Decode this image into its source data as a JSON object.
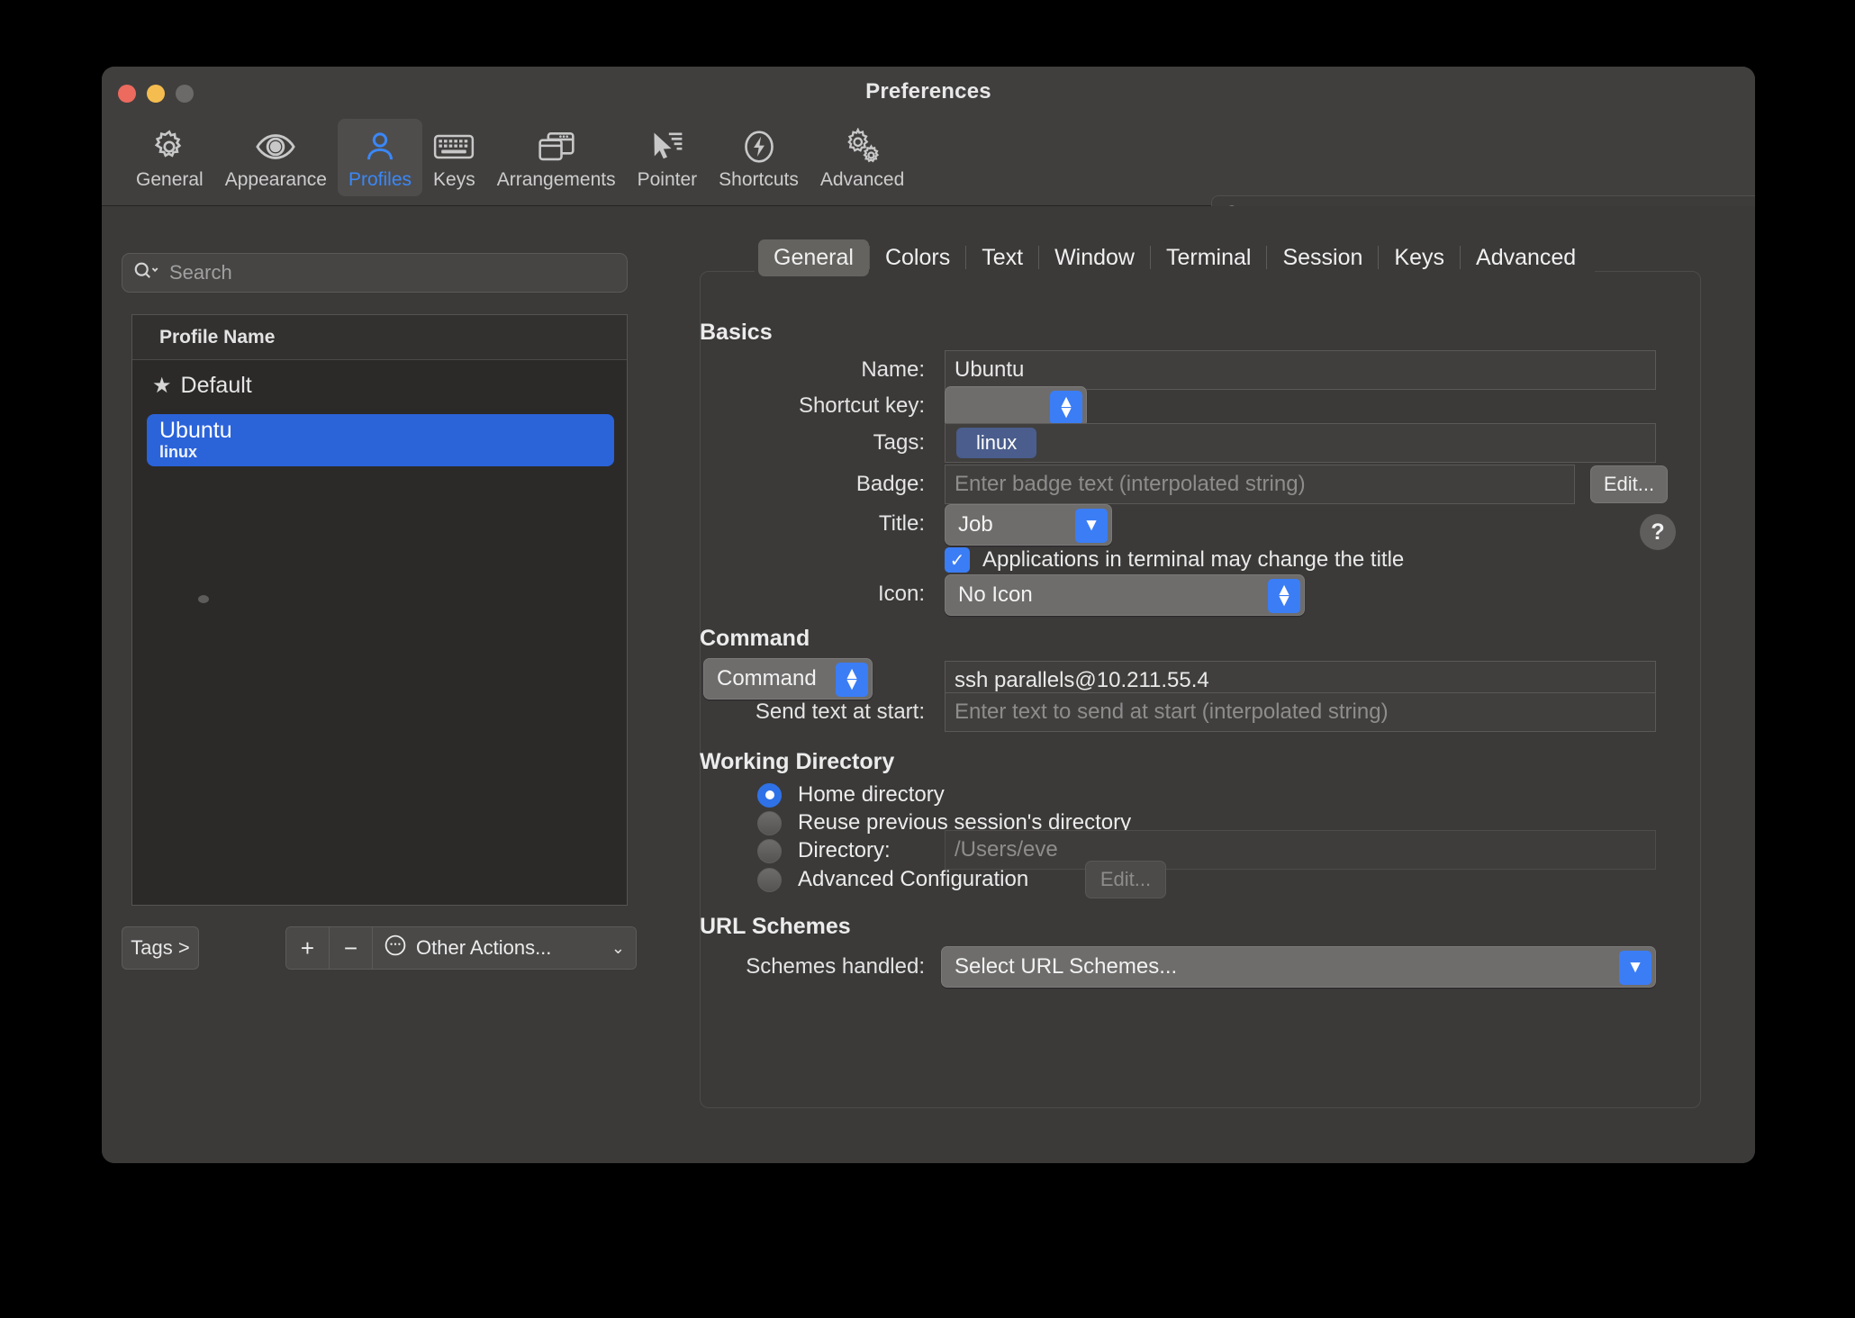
{
  "window": {
    "title": "Preferences",
    "traffic_lights": [
      "close",
      "minimize",
      "zoom"
    ]
  },
  "toolbar": {
    "items": [
      {
        "label": "General",
        "icon": "gear-icon",
        "selected": false
      },
      {
        "label": "Appearance",
        "icon": "eye-icon",
        "selected": false
      },
      {
        "label": "Profiles",
        "icon": "person-icon",
        "selected": true
      },
      {
        "label": "Keys",
        "icon": "keyboard-icon",
        "selected": false
      },
      {
        "label": "Arrangements",
        "icon": "windows-icon",
        "selected": false
      },
      {
        "label": "Pointer",
        "icon": "cursor-icon",
        "selected": false
      },
      {
        "label": "Shortcuts",
        "icon": "bolt-icon",
        "selected": false
      },
      {
        "label": "Advanced",
        "icon": "double-gear-icon",
        "selected": false
      }
    ],
    "search": {
      "value": "",
      "placeholder": "Search",
      "caption": "Search"
    }
  },
  "profiles_pane": {
    "search": {
      "value": "",
      "placeholder": "Search"
    },
    "column_header": "Profile Name",
    "rows": [
      {
        "name": "Default",
        "tag": "",
        "is_default": true,
        "selected": false
      },
      {
        "name": "Ubuntu",
        "tag": "linux",
        "is_default": false,
        "selected": true
      }
    ],
    "footer": {
      "tags_button": "Tags >",
      "add_button": "+",
      "remove_button": "−",
      "other_actions": "Other Actions...",
      "other_actions_icon": "ellipsis-circle-icon",
      "chevron": "⌄"
    }
  },
  "tabs": [
    {
      "label": "General",
      "active": true
    },
    {
      "label": "Colors",
      "active": false
    },
    {
      "label": "Text",
      "active": false
    },
    {
      "label": "Window",
      "active": false
    },
    {
      "label": "Terminal",
      "active": false
    },
    {
      "label": "Session",
      "active": false
    },
    {
      "label": "Keys",
      "active": false
    },
    {
      "label": "Advanced",
      "active": false
    }
  ],
  "general_tab": {
    "basics": {
      "heading": "Basics",
      "name": {
        "label": "Name:",
        "value": "Ubuntu"
      },
      "shortcut_key": {
        "label": "Shortcut key:",
        "value": ""
      },
      "tags": {
        "label": "Tags:",
        "chips": [
          "linux"
        ]
      },
      "badge": {
        "label": "Badge:",
        "value": "",
        "placeholder": "Enter badge text (interpolated string)",
        "edit_button": "Edit..."
      },
      "title": {
        "label": "Title:",
        "value": "Job"
      },
      "title_help": "?",
      "apps_may_change_title": {
        "label": "Applications in terminal may change the title",
        "checked": true,
        "check_glyph": "✓"
      },
      "icon": {
        "label": "Icon:",
        "value": "No Icon"
      }
    },
    "command": {
      "heading": "Command",
      "mode": "Command",
      "value": "ssh parallels@10.211.55.4",
      "send_text": {
        "label": "Send text at start:",
        "value": "",
        "placeholder": "Enter text to send at start (interpolated string)"
      }
    },
    "working_directory": {
      "heading": "Working Directory",
      "options": [
        {
          "label": "Home directory",
          "selected": true
        },
        {
          "label": "Reuse previous session's directory",
          "selected": false
        },
        {
          "label": "Directory:",
          "selected": false
        },
        {
          "label": "Advanced Configuration",
          "selected": false
        }
      ],
      "directory_value": "",
      "directory_placeholder": "/Users/eve",
      "advanced_edit_button": "Edit..."
    },
    "url_schemes": {
      "heading": "URL Schemes",
      "schemes_label": "Schemes handled:",
      "schemes_value": "Select URL Schemes..."
    }
  },
  "colors": {
    "accent_blue": "#3b7df5",
    "selection_blue": "#2b63d9",
    "tag_chip": "#4a5d8c",
    "window_bg": "#3b3a39",
    "toolbar_bg": "#403f3e",
    "table_bg": "#2b2a29"
  }
}
